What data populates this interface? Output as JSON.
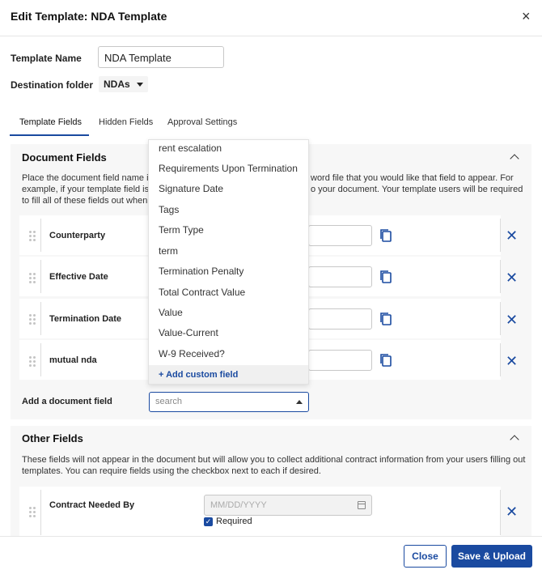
{
  "header": {
    "title": "Edit Template: NDA Template",
    "close_glyph": "×"
  },
  "form": {
    "template_name_label": "Template Name",
    "template_name_value": "NDA Template",
    "destination_label": "Destination folder",
    "destination_value": "NDAs"
  },
  "tabs": [
    {
      "label": "Template Fields",
      "active": true
    },
    {
      "label": "Hidden Fields",
      "active": false
    },
    {
      "label": "Approval Settings",
      "active": false
    }
  ],
  "document_fields": {
    "title": "Document Fields",
    "desc_line1_a": "Place the document field name in",
    "desc_line1_b": "word file that you would like that field to appear. For",
    "desc_line2_a": "example, if your template field is 'C",
    "desc_line2_b": "o your document. Your template users will be required",
    "desc_line3": "to fill all of these fields out when s",
    "rows": [
      {
        "label": "Counterparty"
      },
      {
        "label": "Effective Date"
      },
      {
        "label": "Termination Date"
      },
      {
        "label": "mutual nda"
      }
    ],
    "add_label": "Add a document field",
    "search_placeholder": "search"
  },
  "dropdown": {
    "items": [
      "rent escalation",
      "Requirements Upon Termination",
      "Signature Date",
      "Tags",
      "Term Type",
      "term",
      "Termination Penalty",
      "Total Contract Value",
      "Value",
      "Value-Current",
      "W-9 Received?"
    ],
    "add_custom": "+ Add custom field"
  },
  "other_fields": {
    "title": "Other Fields",
    "desc_line1": "These fields will not appear in the document but will allow you to collect additional contract information from your users filling out",
    "desc_line2": "templates. You can require fields using the checkbox next to each if desired.",
    "row_label": "Contract Needed By",
    "date_placeholder": "MM/DD/YYYY",
    "required_label": "Required",
    "required_checked": true
  },
  "footer": {
    "close_label": "Close",
    "save_label": "Save & Upload"
  },
  "colors": {
    "accent": "#1a4aa0",
    "section_bg": "#f7f7f7"
  },
  "icons": {
    "copy": "copy-icon",
    "remove": "close-icon",
    "drag": "drag-handle-icon",
    "calendar": "calendar-icon"
  }
}
